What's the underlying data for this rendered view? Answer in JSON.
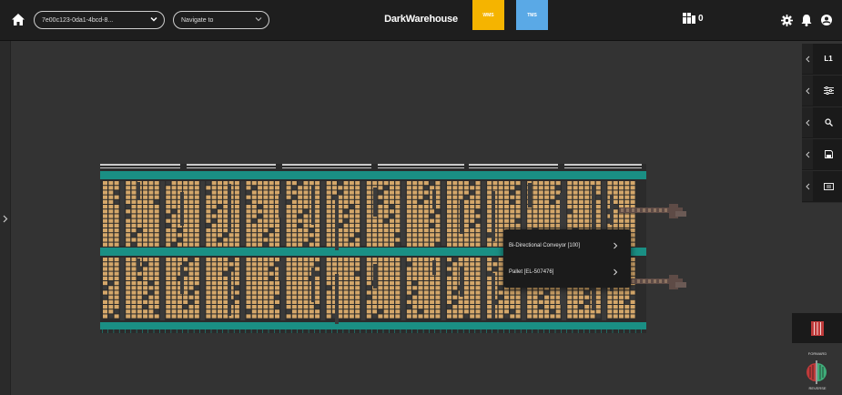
{
  "header": {
    "home_icon": "home-icon",
    "instance_select": {
      "value": "7e00c123-0da1-4bcd-8..."
    },
    "navigate_select": {
      "value": "Navigate to"
    },
    "title": "DarkWarehouse",
    "badges": [
      {
        "label": "WMS",
        "color": "#f5b400"
      },
      {
        "label": "TMS",
        "color": "#5aa9e6"
      }
    ],
    "counter": {
      "icon": "robot-group-icon",
      "value": "0"
    },
    "settings_icon": "gear-icon",
    "notifications_icon": "bell-icon",
    "account_icon": "user-icon"
  },
  "right_toolbar": {
    "tools": [
      {
        "name": "level",
        "label": "L1"
      },
      {
        "name": "filters",
        "icon": "sliders-icon"
      },
      {
        "name": "search",
        "icon": "search-icon"
      },
      {
        "name": "save",
        "icon": "save-icon"
      },
      {
        "name": "panel",
        "icon": "panel-icon"
      }
    ]
  },
  "controls": {
    "forward_label": "FORWARD",
    "reverse_label": "REVERSE",
    "stop_icon": "stop-icon"
  },
  "context_menu": {
    "items": [
      {
        "label": "Bi-Directional Conveyor [100]"
      },
      {
        "label": "Pallet [EL-507476]"
      }
    ]
  },
  "colors": {
    "background": "#333333",
    "topbar": "#1e1e1e",
    "rack": "#d4a76a",
    "aisle": "#3a3a3a",
    "conveyor": "#1a8f84"
  }
}
